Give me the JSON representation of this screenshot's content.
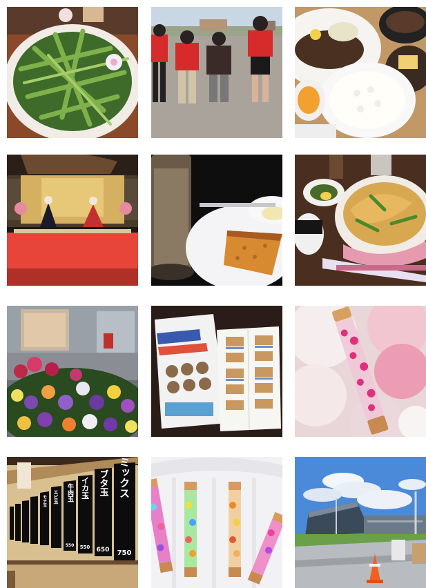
{
  "gallery": {
    "tiles": [
      {
        "id": "salad-bowl"
      },
      {
        "id": "kids-field"
      },
      {
        "id": "set-meal"
      },
      {
        "id": "hina-dolls"
      },
      {
        "id": "cafe-pie"
      },
      {
        "id": "tempura-udon"
      },
      {
        "id": "pansy-flowers"
      },
      {
        "id": "brochure"
      },
      {
        "id": "herbarium-pen"
      },
      {
        "id": "okonomiyaki-menu"
      },
      {
        "id": "herbarium-pens"
      },
      {
        "id": "station-sky"
      }
    ],
    "menu_signs": [
      "ミックス",
      "ブタ玉",
      "イカ玉",
      "牛肉玉",
      "エビ玉",
      "モチ玉"
    ],
    "menu_prices": [
      "750",
      "650",
      "550",
      "550"
    ]
  }
}
